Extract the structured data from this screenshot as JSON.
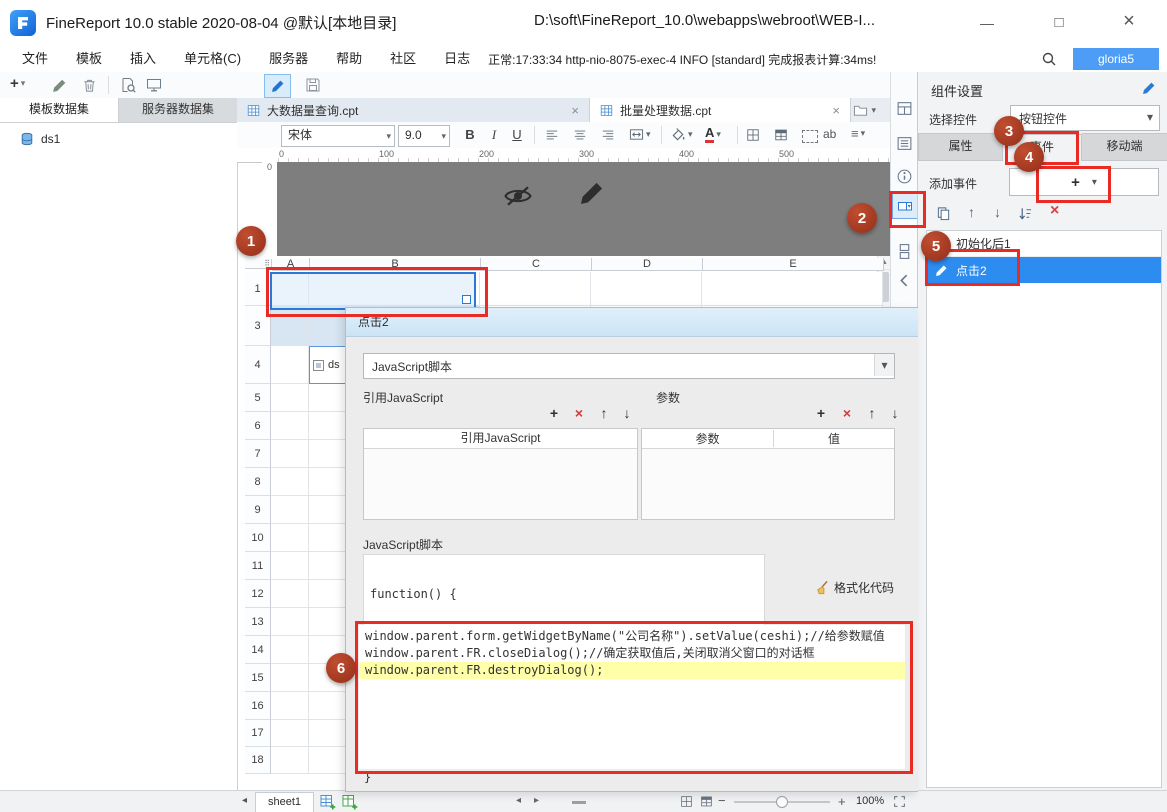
{
  "title_bar": {
    "app_title": "FineReport 10.0 stable 2020-08-04 @默认[本地目录]",
    "workspace_path": "D:\\soft\\FineReport_10.0\\webapps\\webroot\\WEB-I...",
    "window": {
      "minimize": "—",
      "maximize": "□",
      "close": "×"
    }
  },
  "menu_bar": {
    "items": [
      "文件",
      "模板",
      "插入",
      "单元格(C)",
      "服务器",
      "帮助",
      "社区",
      "日志"
    ],
    "status_text": "正常:17:33:34 http-nio-8075-exec-4 INFO [standard] 完成报表计算:34ms!",
    "user": "gloria5"
  },
  "left_panel": {
    "tabs": [
      "模板数据集",
      "服务器数据集"
    ],
    "datasets": [
      {
        "name": "ds1"
      }
    ]
  },
  "document_tabs": [
    {
      "label": "大数据量查询.cpt"
    },
    {
      "label": "批量处理数据.cpt"
    }
  ],
  "format_toolbar": {
    "font_family": "宋体",
    "font_size": "9.0",
    "bold": "B",
    "italic": "I",
    "underline": "U",
    "ab": "ab"
  },
  "ruler": {
    "h_ticks": [
      "0",
      "100",
      "200",
      "300",
      "400",
      "500"
    ],
    "v_origin": "0"
  },
  "spreadsheet": {
    "columns": [
      "A",
      "B",
      "C",
      "D",
      "E"
    ],
    "rows": [
      "1",
      "3",
      "4",
      "5",
      "6",
      "7",
      "8",
      "9",
      "10",
      "11",
      "12",
      "13",
      "14",
      "15",
      "16",
      "17",
      "18"
    ],
    "cell_b4_text": "ds"
  },
  "event_dialog": {
    "title": "点击2",
    "event_type": "JavaScript脚本",
    "ref_js_label": "引用JavaScript",
    "params_label": "参数",
    "ref_table_header": "引用JavaScript",
    "param_table_headers": [
      "参数",
      "值"
    ],
    "js_label": "JavaScript脚本",
    "function_open": "function() {",
    "function_close": "}",
    "format_code_label": "格式化代码",
    "code_lines": [
      "window.parent.form.getWidgetByName(\"公司名称\").setValue(ceshi);//给参数赋值",
      "window.parent.FR.closeDialog();//确定获取值后,关闭取消父窗口的对话框",
      "window.parent.FR.destroyDialog();"
    ]
  },
  "right_panel": {
    "title": "组件设置",
    "select_widget_label": "选择控件",
    "selected_widget": "按钮控件",
    "tabs": [
      "属性",
      "事件",
      "移动端"
    ],
    "add_event_label": "添加事件",
    "events": [
      {
        "label": "初始化后1"
      },
      {
        "label": "点击2"
      }
    ]
  },
  "bottom_bar": {
    "sheet_name": "sheet1",
    "zoom": "100%"
  },
  "annotations": [
    "1",
    "2",
    "3",
    "4",
    "5",
    "6"
  ],
  "glyphs": {
    "dropdown": "▾",
    "plus": "+",
    "close": "×",
    "up": "↑",
    "down": "↓",
    "drag": "⠿",
    "left_tri": "◂",
    "right_tri": "▸",
    "minus": "−",
    "scroll_up": "▲",
    "menu": "≡",
    "font_a": "A"
  },
  "colors": {
    "accent_blue": "#2d8cf0",
    "annotation_red": "#a83a24",
    "box_red": "#ea2b23",
    "line_highlight": "#ffffaa",
    "user_badge": "#4d9df6"
  }
}
